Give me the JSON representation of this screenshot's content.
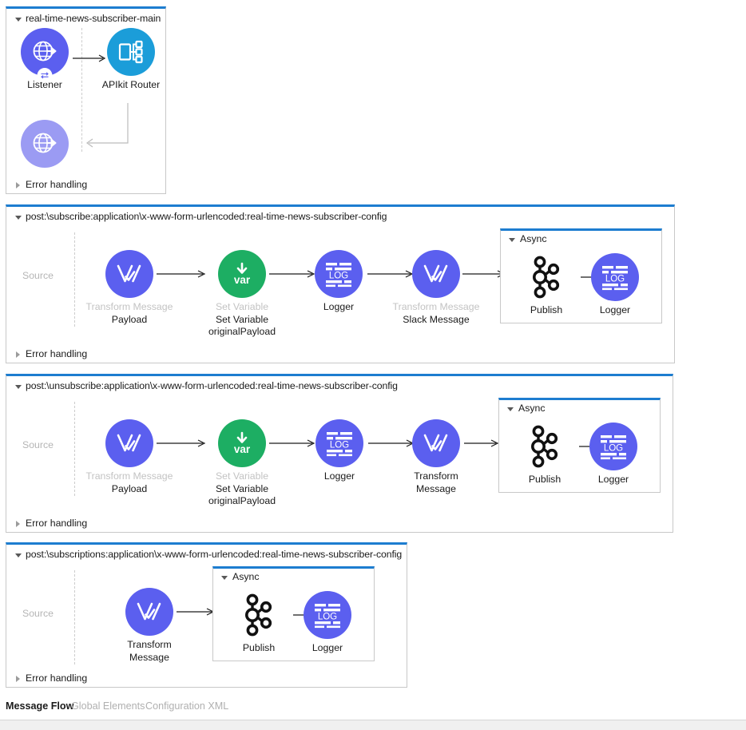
{
  "editor": {
    "tabs": [
      {
        "label": "Message Flow",
        "active": true
      },
      {
        "label": "Global Elements",
        "active": false
      },
      {
        "label": "Configuration XML",
        "active": false
      }
    ]
  },
  "common": {
    "source_label": "Source",
    "error_handling_label": "Error handling",
    "async_label": "Async"
  },
  "flows": [
    {
      "name": "real-time-news-subscriber-main",
      "error_handling": "Error handling",
      "nodes": [
        {
          "label": "Listener",
          "icon": "http-listener-icon",
          "color": "#5b5fef"
        },
        {
          "label": "APIkit Router",
          "icon": "apikit-router-icon",
          "color": "#1b9dd9"
        },
        {
          "label": "",
          "icon": "http-response-icon",
          "color": "#9b9bf3"
        }
      ]
    },
    {
      "name": "post:\\subscribe:application\\x-www-form-urlencoded:real-time-news-subscriber-config",
      "source_label": "Source",
      "error_handling": "Error handling",
      "nodes": [
        {
          "label": "Transform Message",
          "sub": "Payload",
          "icon": "transform-message-icon",
          "color": "#5b5fef",
          "muted": true
        },
        {
          "label": "Set Variable",
          "sub": "Set Variable\noriginalPayload",
          "icon": "set-variable-icon",
          "color": "#1dae63",
          "muted": true
        },
        {
          "label": "Logger",
          "sub": "",
          "icon": "logger-icon",
          "color": "#5b5fef",
          "muted": false
        },
        {
          "label": "Transform Message",
          "sub": "Slack Message",
          "icon": "transform-message-icon",
          "color": "#5b5fef",
          "muted": true
        }
      ],
      "async": {
        "label": "Async",
        "nodes": [
          {
            "label": "Publish",
            "icon": "kafka-publish-icon",
            "color": "#111111"
          },
          {
            "label": "Logger",
            "icon": "logger-icon",
            "color": "#5b5fef"
          }
        ]
      }
    },
    {
      "name": "post:\\unsubscribe:application\\x-www-form-urlencoded:real-time-news-subscriber-config",
      "source_label": "Source",
      "error_handling": "Error handling",
      "nodes": [
        {
          "label": "Transform Message",
          "sub": "Payload",
          "icon": "transform-message-icon",
          "color": "#5b5fef",
          "muted": true
        },
        {
          "label": "Set Variable",
          "sub": "Set Variable\noriginalPayload",
          "icon": "set-variable-icon",
          "color": "#1dae63",
          "muted": true
        },
        {
          "label": "Logger",
          "sub": "",
          "icon": "logger-icon",
          "color": "#5b5fef",
          "muted": false
        },
        {
          "label": "Transform\nMessage",
          "sub": "",
          "icon": "transform-message-icon",
          "color": "#5b5fef",
          "muted": false
        }
      ],
      "async": {
        "label": "Async",
        "nodes": [
          {
            "label": "Publish",
            "icon": "kafka-publish-icon",
            "color": "#111111"
          },
          {
            "label": "Logger",
            "icon": "logger-icon",
            "color": "#5b5fef"
          }
        ]
      }
    },
    {
      "name": "post:\\subscriptions:application\\x-www-form-urlencoded:real-time-news-subscriber-config",
      "source_label": "Source",
      "error_handling": "Error handling",
      "nodes": [
        {
          "label": "Transform\nMessage",
          "sub": "",
          "icon": "transform-message-icon",
          "color": "#5b5fef",
          "muted": false
        }
      ],
      "async": {
        "label": "Async",
        "nodes": [
          {
            "label": "Publish",
            "icon": "kafka-publish-icon",
            "color": "#111111"
          },
          {
            "label": "Logger",
            "icon": "logger-icon",
            "color": "#5b5fef"
          }
        ]
      }
    }
  ],
  "labels": {
    "f1_n0": "Listener",
    "f1_n1": "APIkit Router",
    "f1_title": "real-time-news-subscriber-main",
    "f1_err": "Error handling",
    "f2_title": "post:\\subscribe:application\\x-www-form-urlencoded:real-time-news-subscriber-config",
    "f2_src": "Source",
    "f2_err": "Error handling",
    "f2_n0": "Transform Message",
    "f2_n0s": "Payload",
    "f2_n1": "Set Variable",
    "f2_n1s1": "Set Variable",
    "f2_n1s2": "originalPayload",
    "f2_n2": "Logger",
    "f2_n3": "Transform Message",
    "f2_n3s": "Slack Message",
    "f2_async": "Async",
    "f2_a0": "Publish",
    "f2_a1": "Logger",
    "f3_title": "post:\\unsubscribe:application\\x-www-form-urlencoded:real-time-news-subscriber-config",
    "f3_src": "Source",
    "f3_err": "Error handling",
    "f3_n0": "Transform Message",
    "f3_n0s": "Payload",
    "f3_n1": "Set Variable",
    "f3_n1s1": "Set Variable",
    "f3_n1s2": "originalPayload",
    "f3_n2": "Logger",
    "f3_n3a": "Transform",
    "f3_n3b": "Message",
    "f3_async": "Async",
    "f3_a0": "Publish",
    "f3_a1": "Logger",
    "f4_title": "post:\\subscriptions:application\\x-www-form-urlencoded:real-time-news-subscriber-config",
    "f4_src": "Source",
    "f4_err": "Error handling",
    "f4_n0a": "Transform",
    "f4_n0b": "Message",
    "f4_async": "Async",
    "f4_a0": "Publish",
    "f4_a1": "Logger",
    "tab0": "Message Flow",
    "tab1": "Global Elements",
    "tab2": "Configuration XML"
  },
  "colors": {
    "accent_blue": "#1d7dd0",
    "node_purple": "#5b5fef",
    "node_purple_light": "#9b9bf3",
    "node_green": "#1dae63",
    "node_cyan": "#1b9dd9",
    "kafka_black": "#111111",
    "border_grey": "#c8c8c8",
    "muted_text": "#c3c3c3"
  }
}
